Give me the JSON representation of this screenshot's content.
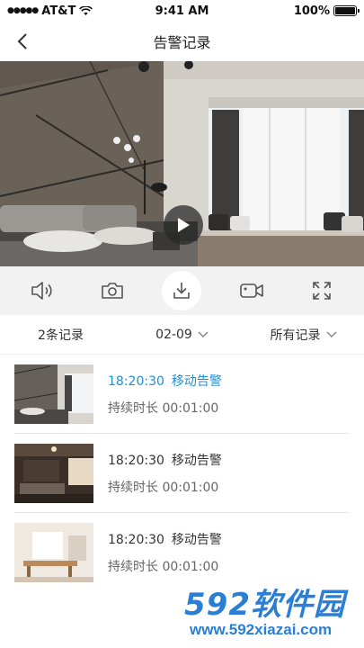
{
  "status_bar": {
    "carrier": "AT&T",
    "time": "9:41 AM",
    "battery_percent": "100%",
    "battery_level": 1.0
  },
  "nav": {
    "title": "告警记录"
  },
  "controls": {
    "items": [
      "speaker-icon",
      "camera-icon",
      "download-icon",
      "video-record-icon",
      "fullscreen-icon"
    ],
    "active": "download-icon"
  },
  "filter": {
    "count": "2条记录",
    "date": "02-09",
    "type": "所有记录"
  },
  "records": [
    {
      "time": "18:20:30",
      "event": "移动告警",
      "duration": "持续时长 00:01:00",
      "highlight": true
    },
    {
      "time": "18:20:30",
      "event": "移动告警",
      "duration": "持续时长 00:01:00",
      "highlight": false
    },
    {
      "time": "18:20:30",
      "event": "移动告警",
      "duration": "持续时长 00:01:00",
      "highlight": false
    }
  ],
  "watermark": {
    "logo_text": "592软件园",
    "url": "www.592xiazai.com"
  },
  "colors": {
    "highlight": "#1f8fd6",
    "watermark": "#2a7fd4",
    "control_bg": "#f2f2f2"
  }
}
